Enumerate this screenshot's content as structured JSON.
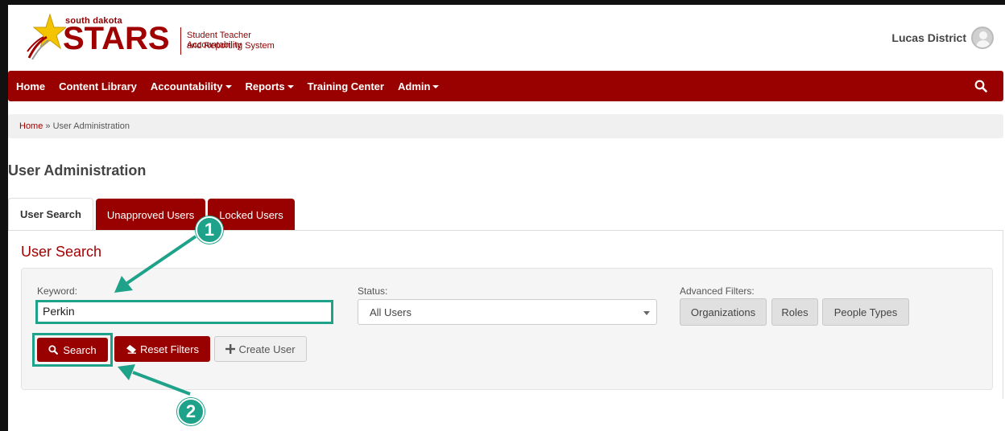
{
  "header": {
    "logo_small": "south dakota",
    "logo_big": "STARS",
    "logo_sub1": "Student Teacher Accountability",
    "logo_sub2": "and Reporting System",
    "user_name": "Lucas District"
  },
  "nav": {
    "items": [
      {
        "label": "Home",
        "dropdown": false
      },
      {
        "label": "Content Library",
        "dropdown": false
      },
      {
        "label": "Accountability",
        "dropdown": true
      },
      {
        "label": "Reports",
        "dropdown": true
      },
      {
        "label": "Training Center",
        "dropdown": false
      },
      {
        "label": "Admin",
        "dropdown": true
      }
    ],
    "search_icon": "search-icon"
  },
  "breadcrumb": {
    "home": "Home",
    "separator": "»",
    "current": "User Administration"
  },
  "page": {
    "title": "User Administration"
  },
  "tabs": [
    {
      "label": "User Search",
      "active": true
    },
    {
      "label": "Unapproved Users",
      "active": false
    },
    {
      "label": "Locked Users",
      "active": false
    }
  ],
  "search": {
    "section_title": "User Search",
    "keyword_label": "Keyword:",
    "keyword_value": "Perkin",
    "status_label": "Status:",
    "status_value": "All Users",
    "advanced_label": "Advanced Filters:",
    "filters": [
      "Organizations",
      "Roles",
      "People Types"
    ],
    "search_button": "Search",
    "reset_button": "Reset Filters",
    "create_button": "Create User"
  },
  "callouts": {
    "one": "1",
    "two": "2"
  },
  "colors": {
    "brand": "#990000",
    "highlight": "#1fa28a"
  }
}
